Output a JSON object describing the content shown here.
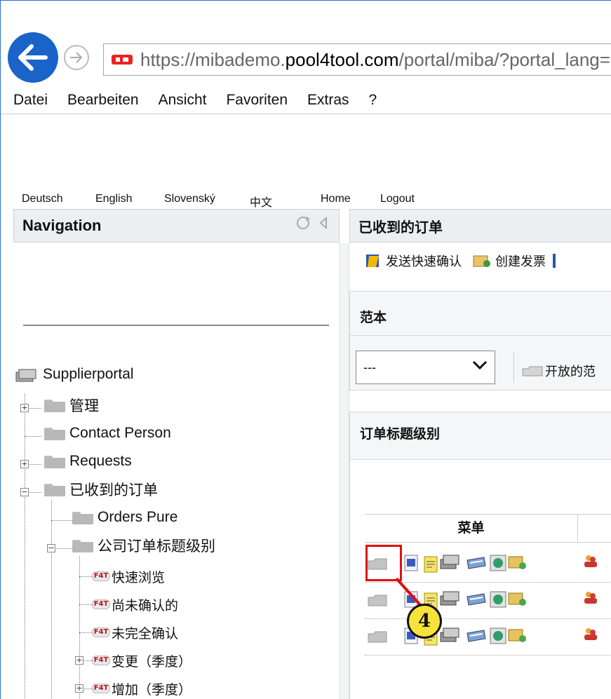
{
  "browser": {
    "url_scheme": "https://",
    "url_sub": "mibademo.",
    "url_host": "pool4tool.com",
    "url_path": "/portal/miba/?portal_lang=ch",
    "back_icon": "arrow-left-icon",
    "forward_icon": "arrow-right-icon"
  },
  "menubar": [
    "Datei",
    "Bearbeiten",
    "Ansicht",
    "Favoriten",
    "Extras",
    "?"
  ],
  "languages": {
    "de": "Deutsch",
    "en": "English",
    "sk": "Slovenský",
    "zh": "中文",
    "home": "Home",
    "logout": "Logout"
  },
  "nav": {
    "title": "Navigation",
    "tree": {
      "root": "Supplierportal",
      "admin": "管理",
      "contact": "Contact Person",
      "requests": "Requests",
      "orders": "已收到的订单",
      "orders_pure": "Orders Pure",
      "company_header": "公司订单标题级别",
      "quick_view": "快速浏览",
      "unconfirmed": "尚未确认的",
      "partially": "未完全确认",
      "changes": "变更（季度）",
      "increase": "增加（季度）"
    }
  },
  "main": {
    "title": "已收到的订单",
    "toolbar": {
      "send_quick_confirm": "发送快速确认",
      "create_invoice": "创建发票"
    },
    "template": {
      "title": "范本",
      "select_value": "---",
      "open_template": "开放的范"
    },
    "order_header": {
      "title": "订单标题级别",
      "grid_menu_header": "菜单"
    }
  },
  "callout": {
    "number": "4"
  },
  "colors": {
    "brand_blue": "#1a63c9",
    "highlight_red": "#e01010",
    "badge_yellow": "#f5e33a"
  }
}
